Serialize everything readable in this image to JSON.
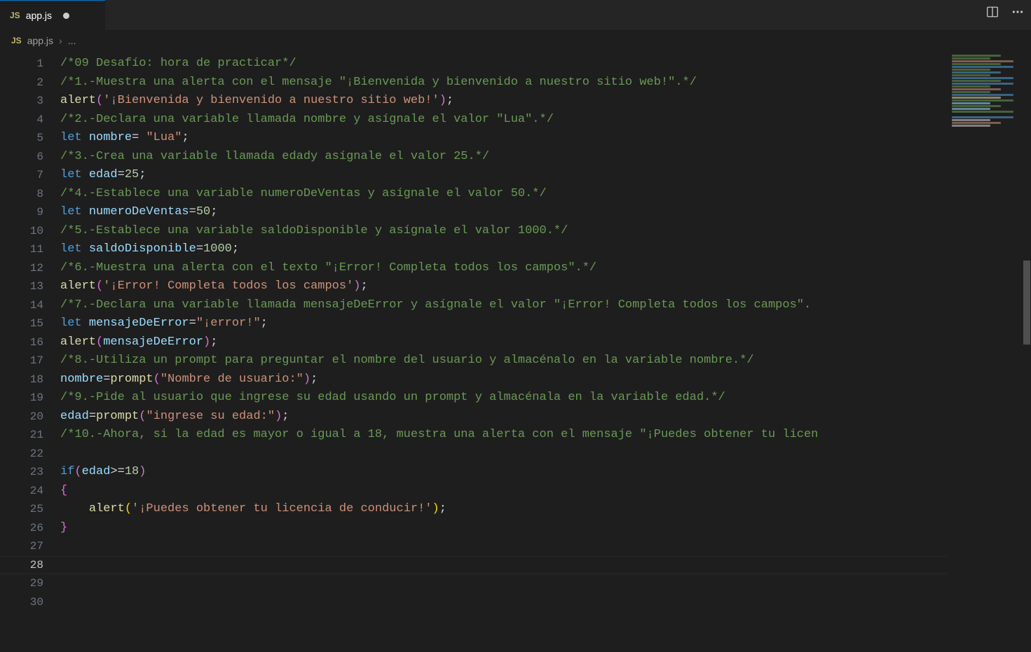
{
  "tab": {
    "icon_label": "JS",
    "filename": "app.js",
    "dirty": true
  },
  "breadcrumb": {
    "icon_label": "JS",
    "filename": "app.js",
    "sep": "›",
    "tail": "..."
  },
  "titlebar": {
    "split_icon": "split-editor-icon",
    "more_icon": "more-icon"
  },
  "editor": {
    "active_line": 28,
    "lines": [
      {
        "n": 1,
        "t": [
          {
            "c": "c-comment",
            "v": "/*09 Desafío: hora de practicar*/"
          }
        ]
      },
      {
        "n": 2,
        "t": [
          {
            "c": "c-comment",
            "v": "/*1.-Muestra una alerta con el mensaje \"¡Bienvenida y bienvenido a nuestro sitio web!\".*/"
          }
        ]
      },
      {
        "n": 3,
        "t": [
          {
            "c": "c-fn",
            "v": "alert"
          },
          {
            "c": "c-brace",
            "v": "("
          },
          {
            "c": "c-str",
            "v": "'¡Bienvenida y bienvenido a nuestro sitio web!'"
          },
          {
            "c": "c-brace",
            "v": ")"
          },
          {
            "c": "c-pun",
            "v": ";"
          }
        ]
      },
      {
        "n": 4,
        "t": [
          {
            "c": "c-comment",
            "v": "/*2.-Declara una variable llamada nombre y asígnale el valor \"Lua\".*/"
          }
        ]
      },
      {
        "n": 5,
        "t": [
          {
            "c": "c-kw",
            "v": "let"
          },
          {
            "c": "",
            "v": " "
          },
          {
            "c": "c-var",
            "v": "nombre"
          },
          {
            "c": "c-pun",
            "v": "= "
          },
          {
            "c": "c-str",
            "v": "\"Lua\""
          },
          {
            "c": "c-pun",
            "v": ";"
          }
        ]
      },
      {
        "n": 6,
        "t": [
          {
            "c": "c-comment",
            "v": "/*3.-Crea una variable llamada edady asígnale el valor 25.*/"
          }
        ]
      },
      {
        "n": 7,
        "t": [
          {
            "c": "c-kw",
            "v": "let"
          },
          {
            "c": "",
            "v": " "
          },
          {
            "c": "c-var",
            "v": "edad"
          },
          {
            "c": "c-pun",
            "v": "="
          },
          {
            "c": "c-num",
            "v": "25"
          },
          {
            "c": "c-pun",
            "v": ";"
          }
        ]
      },
      {
        "n": 8,
        "t": [
          {
            "c": "c-comment",
            "v": "/*4.-Establece una variable numeroDeVentas y asígnale el valor 50.*/"
          }
        ]
      },
      {
        "n": 9,
        "t": [
          {
            "c": "c-kw",
            "v": "let"
          },
          {
            "c": "",
            "v": " "
          },
          {
            "c": "c-var",
            "v": "numeroDeVentas"
          },
          {
            "c": "c-pun",
            "v": "="
          },
          {
            "c": "c-num",
            "v": "50"
          },
          {
            "c": "c-pun",
            "v": ";"
          }
        ]
      },
      {
        "n": 10,
        "t": [
          {
            "c": "c-comment",
            "v": "/*5.-Establece una variable saldoDisponible y asígnale el valor 1000.*/"
          }
        ]
      },
      {
        "n": 11,
        "t": [
          {
            "c": "c-kw",
            "v": "let"
          },
          {
            "c": "",
            "v": " "
          },
          {
            "c": "c-var",
            "v": "saldoDisponible"
          },
          {
            "c": "c-pun",
            "v": "="
          },
          {
            "c": "c-num",
            "v": "1000"
          },
          {
            "c": "c-pun",
            "v": ";"
          }
        ]
      },
      {
        "n": 12,
        "t": [
          {
            "c": "c-comment",
            "v": "/*6.-Muestra una alerta con el texto \"¡Error! Completa todos los campos\".*/"
          }
        ]
      },
      {
        "n": 13,
        "t": [
          {
            "c": "c-fn",
            "v": "alert"
          },
          {
            "c": "c-brace",
            "v": "("
          },
          {
            "c": "c-str",
            "v": "'¡Error! Completa todos los campos'"
          },
          {
            "c": "c-brace",
            "v": ")"
          },
          {
            "c": "c-pun",
            "v": ";"
          }
        ]
      },
      {
        "n": 14,
        "t": [
          {
            "c": "c-comment",
            "v": "/*7.-Declara una variable llamada mensajeDeError y asígnale el valor \"¡Error! Completa todos los campos\"."
          }
        ]
      },
      {
        "n": 15,
        "t": [
          {
            "c": "c-kw",
            "v": "let"
          },
          {
            "c": "",
            "v": " "
          },
          {
            "c": "c-var",
            "v": "mensajeDeError"
          },
          {
            "c": "c-pun",
            "v": "="
          },
          {
            "c": "c-str",
            "v": "\"¡error!\""
          },
          {
            "c": "c-pun",
            "v": ";"
          }
        ]
      },
      {
        "n": 16,
        "t": [
          {
            "c": "c-fn",
            "v": "alert"
          },
          {
            "c": "c-brace",
            "v": "("
          },
          {
            "c": "c-var",
            "v": "mensajeDeError"
          },
          {
            "c": "c-brace",
            "v": ")"
          },
          {
            "c": "c-pun",
            "v": ";"
          }
        ]
      },
      {
        "n": 17,
        "t": [
          {
            "c": "c-comment",
            "v": "/*8.-Utiliza un prompt para preguntar el nombre del usuario y almacénalo en la variable nombre.*/"
          }
        ]
      },
      {
        "n": 18,
        "t": [
          {
            "c": "c-var",
            "v": "nombre"
          },
          {
            "c": "c-pun",
            "v": "="
          },
          {
            "c": "c-fn",
            "v": "prompt"
          },
          {
            "c": "c-brace",
            "v": "("
          },
          {
            "c": "c-str",
            "v": "\"Nombre de usuario:\""
          },
          {
            "c": "c-brace",
            "v": ")"
          },
          {
            "c": "c-pun",
            "v": ";"
          }
        ]
      },
      {
        "n": 19,
        "t": [
          {
            "c": "c-comment",
            "v": "/*9.-Pide al usuario que ingrese su edad usando un prompt y almacénala en la variable edad.*/"
          }
        ]
      },
      {
        "n": 20,
        "t": [
          {
            "c": "c-var",
            "v": "edad"
          },
          {
            "c": "c-pun",
            "v": "="
          },
          {
            "c": "c-fn",
            "v": "prompt"
          },
          {
            "c": "c-brace",
            "v": "("
          },
          {
            "c": "c-str",
            "v": "\"ingrese su edad:\""
          },
          {
            "c": "c-brace",
            "v": ")"
          },
          {
            "c": "c-pun",
            "v": ";"
          }
        ]
      },
      {
        "n": 21,
        "t": [
          {
            "c": "c-comment",
            "v": "/*10.-Ahora, si la edad es mayor o igual a 18, muestra una alerta con el mensaje \"¡Puedes obtener tu licen"
          }
        ]
      },
      {
        "n": 22,
        "t": [
          {
            "c": "",
            "v": ""
          }
        ]
      },
      {
        "n": 23,
        "t": [
          {
            "c": "c-kw",
            "v": "if"
          },
          {
            "c": "c-brace",
            "v": "("
          },
          {
            "c": "c-var",
            "v": "edad"
          },
          {
            "c": "c-pun",
            "v": ">="
          },
          {
            "c": "c-num",
            "v": "18"
          },
          {
            "c": "c-brace",
            "v": ")"
          }
        ]
      },
      {
        "n": 24,
        "t": [
          {
            "c": "c-brace",
            "v": "{"
          }
        ]
      },
      {
        "n": 25,
        "t": [
          {
            "c": "",
            "v": "    "
          },
          {
            "c": "c-fn",
            "v": "alert"
          },
          {
            "c": "c-brace2",
            "v": "("
          },
          {
            "c": "c-str",
            "v": "'¡Puedes obtener tu licencia de conducir!'"
          },
          {
            "c": "c-brace2",
            "v": ")"
          },
          {
            "c": "c-pun",
            "v": ";"
          }
        ]
      },
      {
        "n": 26,
        "t": [
          {
            "c": "c-brace",
            "v": "}"
          }
        ]
      },
      {
        "n": 27,
        "t": [
          {
            "c": "",
            "v": ""
          }
        ]
      },
      {
        "n": 28,
        "t": [
          {
            "c": "",
            "v": ""
          }
        ]
      },
      {
        "n": 29,
        "t": [
          {
            "c": "",
            "v": ""
          }
        ]
      },
      {
        "n": 30,
        "t": [
          {
            "c": "",
            "v": ""
          }
        ]
      }
    ]
  },
  "minimap_colors": [
    "#6a9955",
    "#6a9955",
    "#ce9178",
    "#6a9955",
    "#569cd6",
    "#6a9955",
    "#569cd6",
    "#6a9955",
    "#569cd6",
    "#6a9955",
    "#569cd6",
    "#6a9955",
    "#ce9178",
    "#6a9955",
    "#569cd6",
    "#dcdcaa",
    "#6a9955",
    "#9cdcfe",
    "#6a9955",
    "#9cdcfe",
    "#6a9955",
    "#1e1e1e",
    "#569cd6",
    "#d4d4d4",
    "#ce9178",
    "#d4d4d4"
  ]
}
